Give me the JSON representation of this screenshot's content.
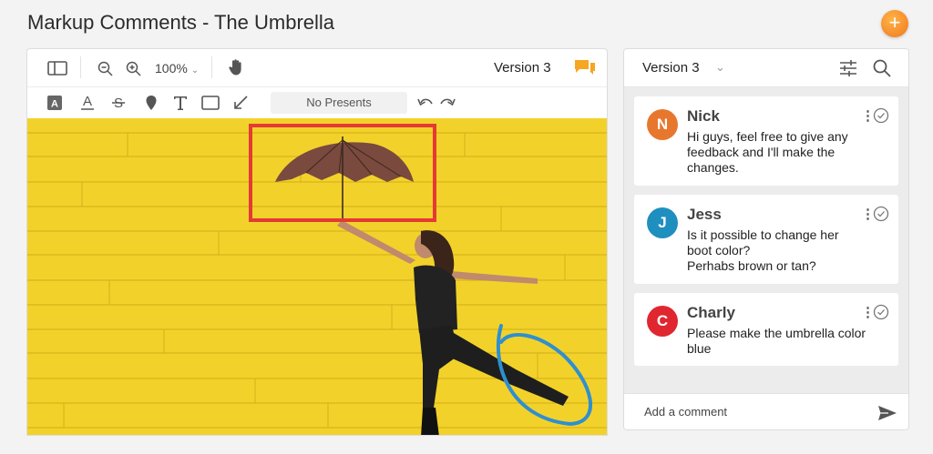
{
  "page": {
    "title": "Markup Comments - The Umbrella"
  },
  "viewer": {
    "zoom": "100%",
    "version": "Version 3",
    "preset": "No Presents"
  },
  "panel": {
    "version": "Version 3",
    "comments": [
      {
        "name": "Nick",
        "initial": "N",
        "color": "#e8772e",
        "text": "Hi guys, feel free to give any\nfeedback and I'll make the\nchanges."
      },
      {
        "name": "Jess",
        "initial": "J",
        "color": "#1f8fbf",
        "text": "Is it possible to change her\nboot color?\nPerhabs brown or tan?"
      },
      {
        "name": "Charly",
        "initial": "C",
        "color": "#e0262f",
        "text": "Please make the umbrella color\nblue"
      }
    ],
    "comment_placeholder": "Add a comment"
  },
  "colors": {
    "accent": "#f5a623",
    "markup_red": "#e53935",
    "markup_blue": "#2f8fd0",
    "background_yellow": "#f2d22a"
  }
}
